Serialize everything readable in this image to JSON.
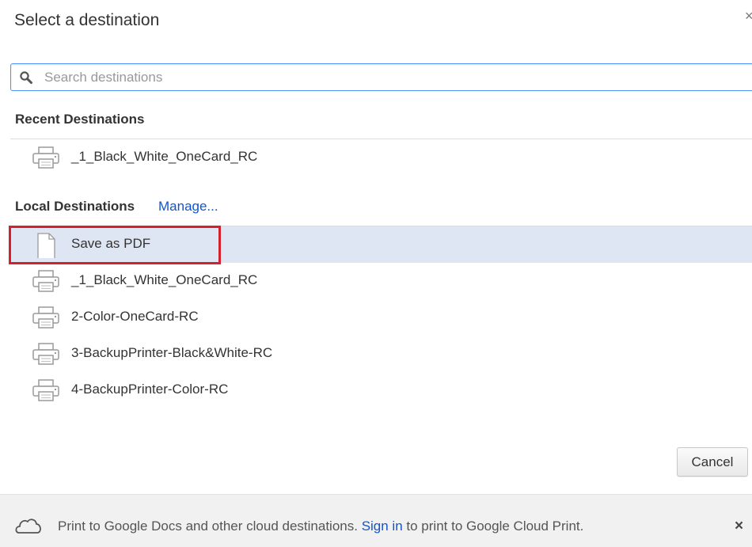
{
  "dialog": {
    "title": "Select a destination",
    "close_glyph": "×"
  },
  "search": {
    "placeholder": "Search destinations",
    "value": "",
    "icon": "search-icon"
  },
  "recent": {
    "header": "Recent Destinations",
    "items": [
      {
        "label": "_1_Black_White_OneCard_RC",
        "icon": "printer-icon"
      }
    ]
  },
  "local": {
    "header": "Local Destinations",
    "manage_label": "Manage...",
    "items": [
      {
        "label": "Save as PDF",
        "icon": "document-icon",
        "selected": true
      },
      {
        "label": "_1_Black_White_OneCard_RC",
        "icon": "printer-icon"
      },
      {
        "label": "2-Color-OneCard-RC",
        "icon": "printer-icon"
      },
      {
        "label": "3-BackupPrinter-Black&White-RC",
        "icon": "printer-icon"
      },
      {
        "label": "4-BackupPrinter-Color-RC",
        "icon": "printer-icon"
      }
    ]
  },
  "buttons": {
    "cancel_label": "Cancel"
  },
  "footer": {
    "text_before": "Print to Google Docs and other cloud destinations.",
    "signin_label": "Sign in",
    "text_after": "to print to Google Cloud Print.",
    "close_glyph": "×",
    "icon": "cloud-icon"
  },
  "colors": {
    "link": "#1155cc",
    "selected_row": "#dfe6f3",
    "highlight_border": "#d3212d",
    "search_focus": "#4d90fe"
  }
}
